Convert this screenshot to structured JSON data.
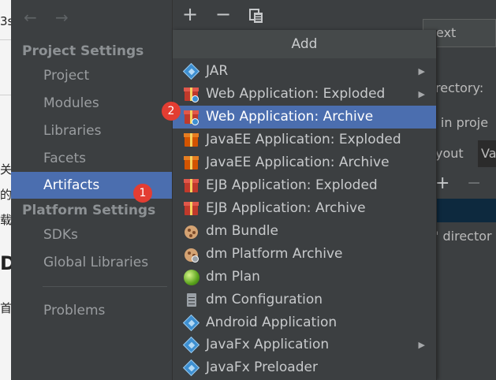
{
  "background_app": {
    "fragments": [
      "3s",
      "关",
      "的",
      "载",
      "D",
      "首"
    ]
  },
  "sidebar": {
    "back_arrow": "←",
    "forward_arrow": "→",
    "project_settings_title": "Project Settings",
    "project_items": [
      {
        "label": "Project"
      },
      {
        "label": "Modules"
      },
      {
        "label": "Libraries"
      },
      {
        "label": "Facets"
      },
      {
        "label": "Artifacts",
        "selected": true
      }
    ],
    "platform_settings_title": "Platform Settings",
    "platform_items": [
      {
        "label": "SDKs"
      },
      {
        "label": "Global Libraries"
      }
    ],
    "problems_label": "Problems"
  },
  "toolbar": {
    "add_symbol": "+",
    "remove_symbol": "−",
    "copy_icon": "copy-icon"
  },
  "right_panel": {
    "name_field_value": "ext",
    "output_directory_label": "rectory:",
    "include_label": "e in proje",
    "tabs": [
      "yout",
      "Va"
    ],
    "description_text": "' director",
    "toolbar_add": "+",
    "toolbar_remove": "−"
  },
  "popup": {
    "title": "Add",
    "items": [
      {
        "label": "JAR",
        "icon": "jar-icon",
        "submenu": true
      },
      {
        "label": "Web Application: Exploded",
        "icon": "web-exploded-icon",
        "submenu": true
      },
      {
        "label": "Web Application: Archive",
        "icon": "web-archive-icon",
        "submenu": false,
        "selected": true
      },
      {
        "label": "JavaEE Application: Exploded",
        "icon": "javaee-exploded-icon",
        "submenu": false
      },
      {
        "label": "JavaEE Application: Archive",
        "icon": "javaee-archive-icon",
        "submenu": false
      },
      {
        "label": "EJB Application: Exploded",
        "icon": "ejb-exploded-icon",
        "submenu": false
      },
      {
        "label": "EJB Application: Archive",
        "icon": "ejb-archive-icon",
        "submenu": false
      },
      {
        "label": "dm Bundle",
        "icon": "dm-bundle-icon",
        "submenu": false
      },
      {
        "label": "dm Platform Archive",
        "icon": "dm-platform-archive-icon",
        "submenu": false
      },
      {
        "label": "dm Plan",
        "icon": "dm-plan-icon",
        "submenu": false
      },
      {
        "label": "dm Configuration",
        "icon": "dm-configuration-icon",
        "submenu": false
      },
      {
        "label": "Android Application",
        "icon": "android-app-icon",
        "submenu": false
      },
      {
        "label": "JavaFx Application",
        "icon": "javafx-app-icon",
        "submenu": true
      },
      {
        "label": "JavaFx Preloader",
        "icon": "javafx-preloader-icon",
        "submenu": false
      }
    ],
    "submenu_arrow": "▶"
  },
  "markers": {
    "artifacts_marker": "1",
    "archive_marker": "2"
  },
  "colors": {
    "selection": "#4b6eaf",
    "marker": "#e33d32",
    "background": "#3c3f41"
  }
}
